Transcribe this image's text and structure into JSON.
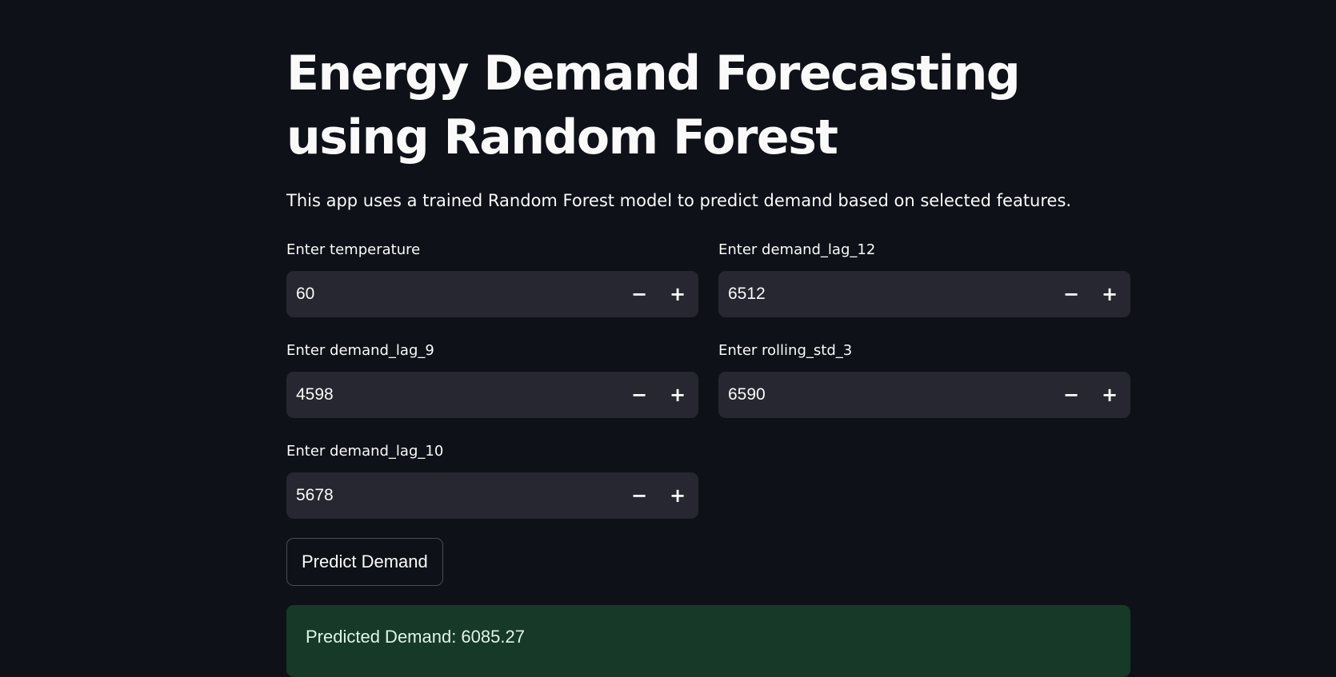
{
  "page": {
    "title": "Energy Demand Forecasting using Random Forest",
    "description": "This app uses a trained Random Forest model to predict demand based on selected features."
  },
  "inputs": {
    "temperature": {
      "label": "Enter temperature",
      "value": "60"
    },
    "demand_lag_12": {
      "label": "Enter demand_lag_12",
      "value": "6512"
    },
    "demand_lag_9": {
      "label": "Enter demand_lag_9",
      "value": "4598"
    },
    "rolling_std_3": {
      "label": "Enter rolling_std_3",
      "value": "6590"
    },
    "demand_lag_10": {
      "label": "Enter demand_lag_10",
      "value": "5678"
    }
  },
  "stepper": {
    "minus": "−",
    "plus": "+"
  },
  "actions": {
    "predict_label": "Predict Demand"
  },
  "result": {
    "text": "Predicted Demand: 6085.27"
  },
  "colors": {
    "background": "#0e1117",
    "input_bg": "#262730",
    "success_bg": "#173928",
    "success_text": "#dff5e3"
  }
}
